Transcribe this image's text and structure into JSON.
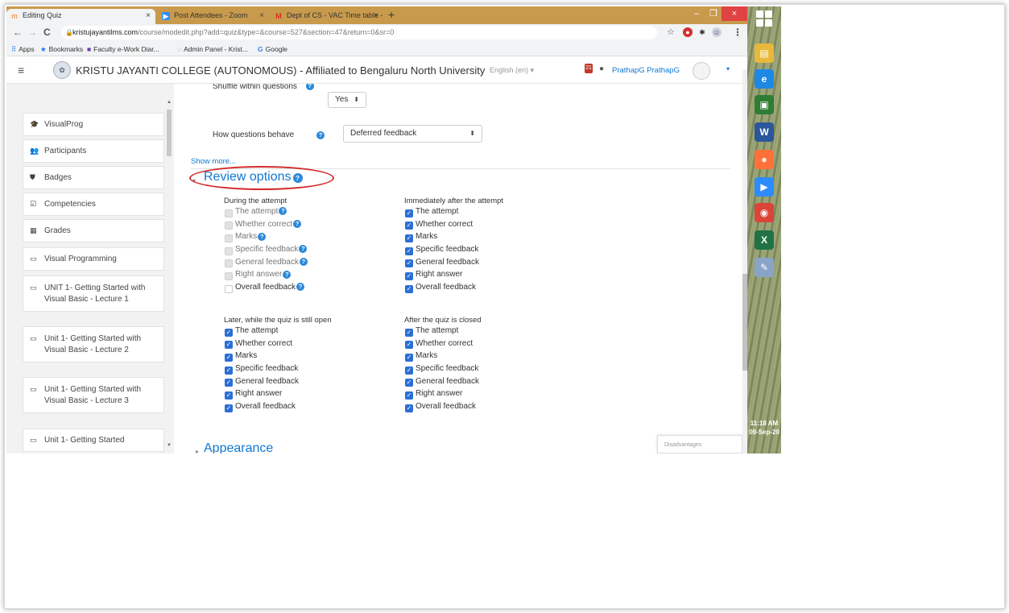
{
  "browser": {
    "tabs": [
      {
        "title": "Editing Quiz",
        "icon": "moodle-icon"
      },
      {
        "title": "Post Attendees - Zoom",
        "icon": "zoom-icon"
      },
      {
        "title": "Dept of CS - VAC Time table - ...",
        "icon": "gmail-icon"
      }
    ],
    "tab_close": "×",
    "new_tab": "+",
    "window_controls": {
      "minimize": "–",
      "maximize": "❐",
      "close": "×"
    },
    "nav": {
      "back": "←",
      "forward": "→",
      "reload": "C"
    },
    "url_host": "kristujayantilms.com",
    "url_path": "/course/modedit.php?add=quiz&type=&course=527&section=47&return=0&sr=0",
    "star": "☆",
    "menu": "⋮",
    "bookmarks": [
      {
        "label": "Apps",
        "icon": "apps-grid-icon"
      },
      {
        "label": "Bookmarks",
        "icon": "star-icon"
      },
      {
        "label": "Faculty e-Work Diar...",
        "icon": "bookmark-page-icon"
      },
      {
        "label": "Admin Panel - Krist...",
        "icon": "bookmark-page-icon"
      },
      {
        "label": "Google",
        "icon": "google-icon"
      }
    ]
  },
  "header": {
    "menu_icon": "≡",
    "site_name": "KRISTU JAYANTI COLLEGE (AUTONOMOUS) - Affiliated to Bengaluru North University",
    "language": "English (en) ▾",
    "notification_count": "21",
    "user_name": "PrathapG PrathapG",
    "dropdown": "▾"
  },
  "sidebar": {
    "items": [
      {
        "label": "VisualProg",
        "icon": "graduation-cap-icon"
      },
      {
        "label": "Participants",
        "icon": "users-icon"
      },
      {
        "label": "Badges",
        "icon": "shield-icon"
      },
      {
        "label": "Competencies",
        "icon": "check-square-icon"
      },
      {
        "label": "Grades",
        "icon": "table-icon"
      },
      {
        "label": "Visual Programming",
        "icon": "folder-icon"
      },
      {
        "label": "UNIT 1- Getting Started with Visual Basic - Lecture 1",
        "icon": "folder-icon"
      },
      {
        "label": "Unit 1- Getting Started with Visual Basic - Lecture 2",
        "icon": "folder-icon"
      },
      {
        "label": "Unit 1- Getting Started with Visual Basic - Lecture 3",
        "icon": "folder-icon"
      },
      {
        "label": "Unit 1- Getting Started",
        "icon": "folder-icon"
      }
    ]
  },
  "form": {
    "shuffle_label": "Shuffle within questions",
    "shuffle_value": "Yes",
    "behave_label": "How questions behave",
    "behave_value": "Deferred feedback",
    "show_more": "Show more...",
    "help": "?",
    "select_arrow": "⬍"
  },
  "review_options": {
    "title": "Review options",
    "groups": [
      {
        "title": "During the attempt",
        "options": [
          {
            "label": "The attempt",
            "state": "disabled",
            "help": true
          },
          {
            "label": "Whether correct",
            "state": "disabled",
            "help": true
          },
          {
            "label": "Marks",
            "state": "disabled",
            "help": true
          },
          {
            "label": "Specific feedback",
            "state": "disabled",
            "help": true
          },
          {
            "label": "General feedback",
            "state": "disabled",
            "help": true
          },
          {
            "label": "Right answer",
            "state": "disabled",
            "help": true
          },
          {
            "label": "Overall feedback",
            "state": "unchecked",
            "help": true
          }
        ]
      },
      {
        "title": "Immediately after the attempt",
        "options": [
          {
            "label": "The attempt",
            "state": "checked"
          },
          {
            "label": "Whether correct",
            "state": "checked"
          },
          {
            "label": "Marks",
            "state": "checked"
          },
          {
            "label": "Specific feedback",
            "state": "checked"
          },
          {
            "label": "General feedback",
            "state": "checked"
          },
          {
            "label": "Right answer",
            "state": "checked"
          },
          {
            "label": "Overall feedback",
            "state": "checked"
          }
        ]
      },
      {
        "title": "Later, while the quiz is still open",
        "options": [
          {
            "label": "The attempt",
            "state": "checked"
          },
          {
            "label": "Whether correct",
            "state": "checked"
          },
          {
            "label": "Marks",
            "state": "checked"
          },
          {
            "label": "Specific feedback",
            "state": "checked"
          },
          {
            "label": "General feedback",
            "state": "checked"
          },
          {
            "label": "Right answer",
            "state": "checked"
          },
          {
            "label": "Overall feedback",
            "state": "checked"
          }
        ]
      },
      {
        "title": "After the quiz is closed",
        "options": [
          {
            "label": "The attempt",
            "state": "checked"
          },
          {
            "label": "Whether correct",
            "state": "checked"
          },
          {
            "label": "Marks",
            "state": "checked"
          },
          {
            "label": "Specific feedback",
            "state": "checked"
          },
          {
            "label": "General feedback",
            "state": "checked"
          },
          {
            "label": "Right answer",
            "state": "checked"
          },
          {
            "label": "Overall feedback",
            "state": "checked"
          }
        ]
      }
    ]
  },
  "next_section": {
    "title": "Appearance"
  },
  "popup_text": "Disadvantages",
  "taskbar": {
    "apps": [
      {
        "icon": "file-explorer-icon",
        "glyph": "▤",
        "color": "#e8b83a"
      },
      {
        "icon": "internet-explorer-icon",
        "glyph": "e",
        "color": "#1e88e5"
      },
      {
        "icon": "ms-store-icon",
        "glyph": "▣",
        "color": "#2e7d32"
      },
      {
        "icon": "word-icon",
        "glyph": "W",
        "color": "#2b579a"
      },
      {
        "icon": "firefox-icon",
        "glyph": "●",
        "color": "#ff7139"
      },
      {
        "icon": "zoom-app-icon",
        "glyph": "▶",
        "color": "#2d8cff"
      },
      {
        "icon": "chrome-icon",
        "glyph": "◉",
        "color": "#db4437"
      },
      {
        "icon": "excel-icon",
        "glyph": "X",
        "color": "#217346"
      },
      {
        "icon": "paint-icon",
        "glyph": "✎",
        "color": "#8aa4c8"
      }
    ],
    "time": "11:18 AM",
    "date": "09-Sep-20"
  },
  "colors": {
    "accent": "#1177d1",
    "checkbox": "#2b6fd6",
    "annotation": "#d32b2b",
    "tabstrip": "#c89a4c"
  }
}
